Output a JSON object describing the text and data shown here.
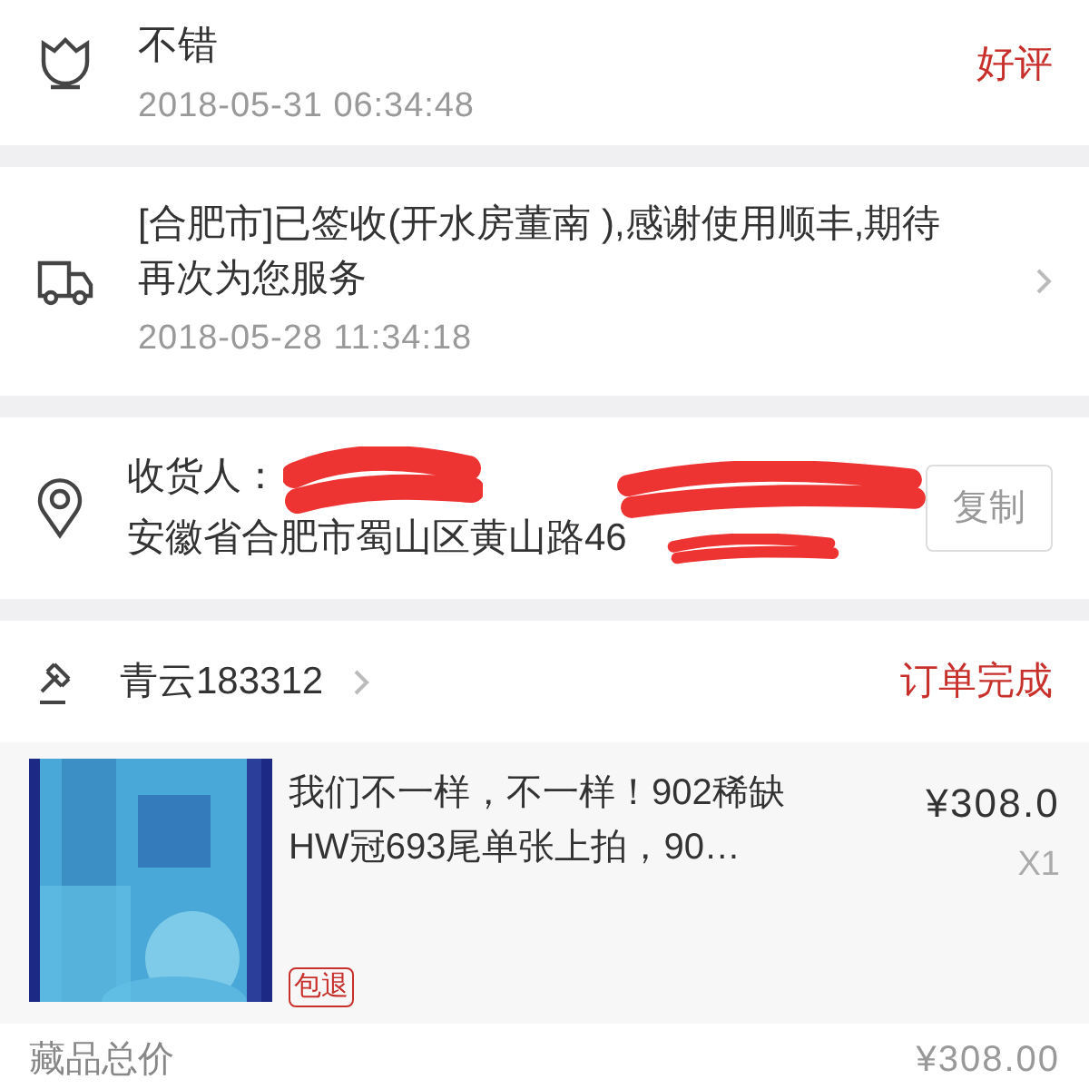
{
  "review": {
    "text": "不错",
    "time": "2018-05-31  06:34:48",
    "rating_label": "好评"
  },
  "logistics": {
    "message": "[合肥市]已签收(开水房董南  ),感谢使用顺丰,期待再次为您服务",
    "time": "2018-05-28  11:34:18"
  },
  "address": {
    "receiver_label": "收货人：",
    "address": "安徽省合肥市蜀山区黄山路46",
    "copy_button": "复制"
  },
  "seller": {
    "name": "青云183312",
    "status": "订单完成"
  },
  "item": {
    "title": "我们不一样，不一样！902稀缺HW冠693尾单张上拍，90…",
    "tag": "包退",
    "price": "¥308.0",
    "quantity": "X1"
  },
  "total": {
    "label": "藏品总价",
    "value": "¥308.00"
  }
}
